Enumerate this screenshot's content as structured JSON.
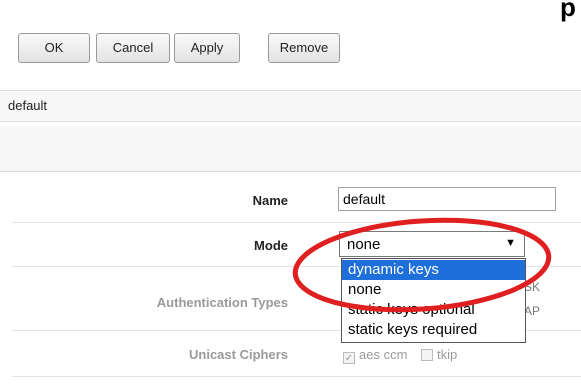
{
  "toolbar": {
    "ok": "OK",
    "cancel": "Cancel",
    "apply": "Apply",
    "remove": "Remove"
  },
  "corner_text": "p",
  "profile_bar": {
    "title": "default"
  },
  "form": {
    "name_label": "Name",
    "name_value": "default",
    "mode_label": "Mode",
    "mode_value": "none",
    "mode_options": [
      "dynamic keys",
      "none",
      "static keys optional",
      "static keys required"
    ],
    "highlighted_option": "dynamic keys",
    "auth_label": "Authentication Types",
    "auth_peek_1": "SK",
    "auth_peek_2": "AP",
    "unicast_label": "Unicast Ciphers",
    "cipher_1": "aes ccm",
    "cipher_1_checked": true,
    "cipher_2": "tkip",
    "cipher_2_checked": false
  },
  "annotation": {
    "color": "#e02020",
    "shape": "ellipse"
  },
  "icons": {
    "dropdown": "chevron-down-icon",
    "checkbox": "check-icon"
  }
}
